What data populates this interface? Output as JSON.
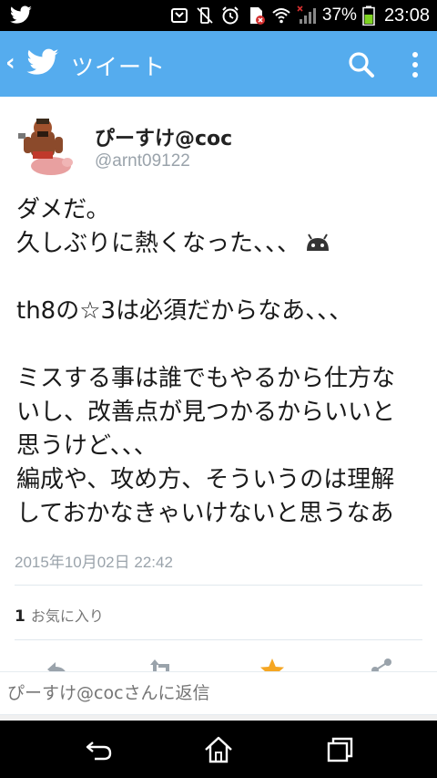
{
  "status_bar": {
    "battery_percent": "37%",
    "time": "23:08"
  },
  "app_bar": {
    "title": "ツイート",
    "accent_color": "#55acee",
    "icons": [
      "back-chevron-icon",
      "twitter-bird-icon",
      "search-icon",
      "more-vert-icon"
    ]
  },
  "tweet": {
    "display_name": "ぴーすけ@coc",
    "handle": "@arnt09122",
    "lines": {
      "l1": "ダメだ。",
      "l2": "久しぶりに熱くなった、、、",
      "l3": "th8の☆3は必須だからなあ、、、",
      "l4": "ミスする事は誰でもやるから仕方な",
      "l5": "いし、改善点が見つかるからいいと",
      "l6": "思うけど、、、",
      "l7": "編成や、攻め方、そういうのは理解",
      "l8": "しておかなきゃいけないと思うなあ"
    },
    "emoji": "android-icon",
    "timestamp": "2015年10月02日 22:42",
    "favorites": {
      "count": "1",
      "label": "お気に入り"
    }
  },
  "actions": [
    "reply-icon",
    "retweet-icon",
    "favorite-star-icon",
    "share-icon"
  ],
  "reply": {
    "placeholder": "ぴーすけ@cocさんに返信"
  },
  "nav_bar": [
    "back-nav-icon",
    "home-nav-icon",
    "recents-nav-icon"
  ]
}
